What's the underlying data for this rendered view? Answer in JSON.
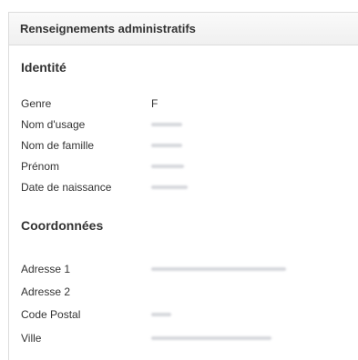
{
  "panel": {
    "title": "Renseignements administratifs"
  },
  "identite": {
    "title": "Identité",
    "rows": [
      {
        "label": "Genre",
        "value": "F"
      },
      {
        "label": "Nom d'usage",
        "value": ""
      },
      {
        "label": "Nom de famille",
        "value": ""
      },
      {
        "label": "Prénom",
        "value": ""
      },
      {
        "label": "Date de naissance",
        "value": ""
      }
    ]
  },
  "coordonnees": {
    "title": "Coordonnées",
    "rows": [
      {
        "label": "Adresse 1",
        "value": ""
      },
      {
        "label": "Adresse 2",
        "value": ""
      },
      {
        "label": "Code Postal",
        "value": ""
      },
      {
        "label": "Ville",
        "value": ""
      }
    ]
  }
}
